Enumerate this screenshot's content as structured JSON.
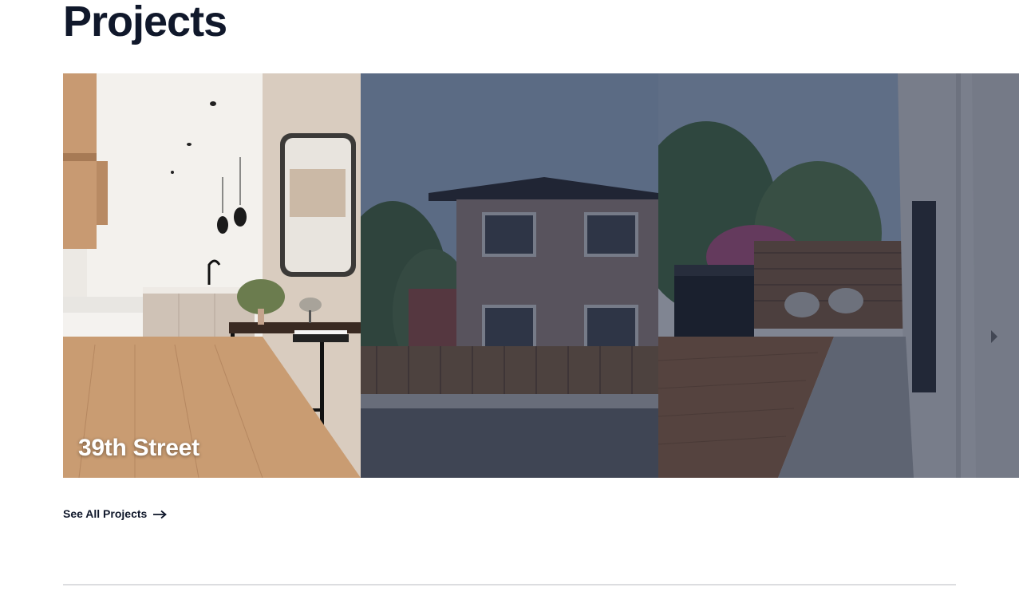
{
  "section": {
    "title": "Projects"
  },
  "projects": [
    {
      "title": "39th Street",
      "active": true
    },
    {
      "title": "",
      "active": false
    },
    {
      "title": "",
      "active": false
    },
    {
      "title": "",
      "active": false
    }
  ],
  "links": {
    "see_all": "See All Projects",
    "see_all_icon": "arrow-right-icon"
  },
  "colors": {
    "heading": "#10182b",
    "overlay": "rgba(24,33,56,0.55)",
    "divider": "#dcdde0"
  }
}
